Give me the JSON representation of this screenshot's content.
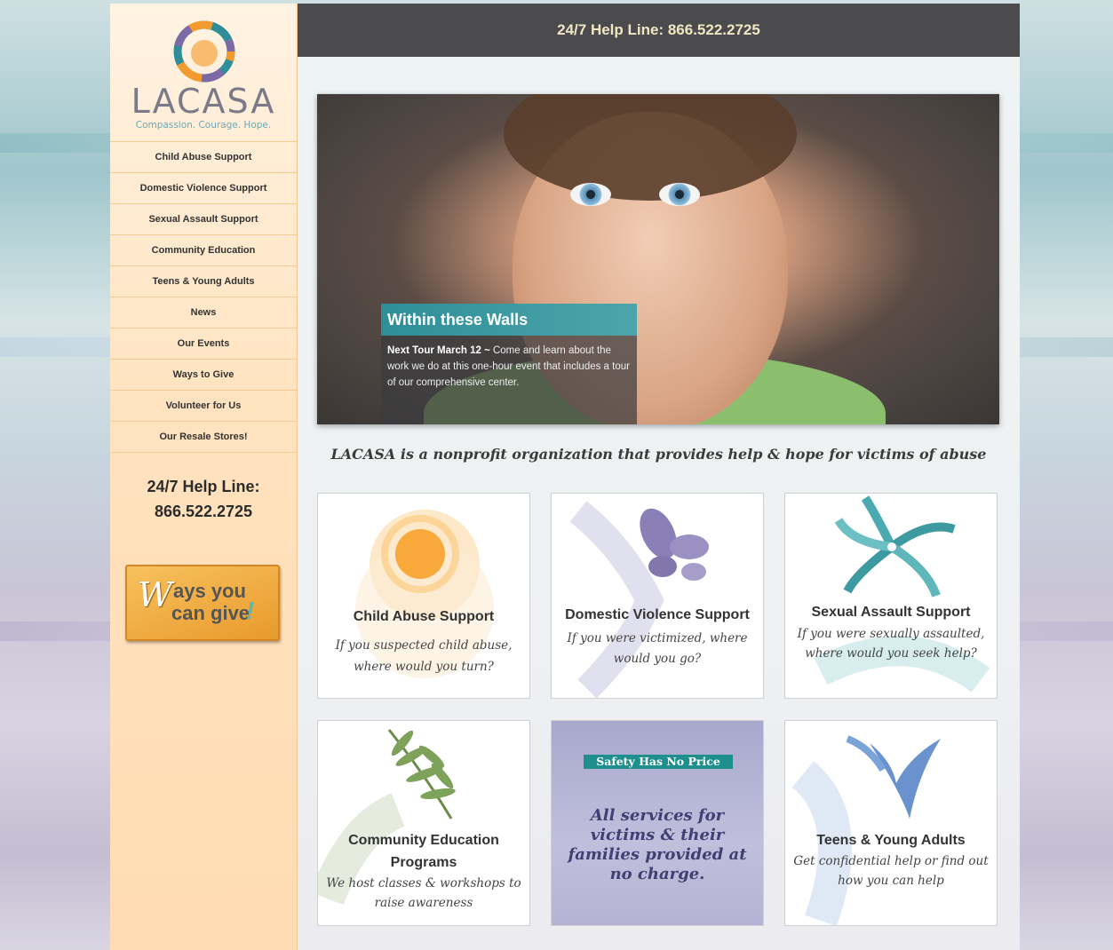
{
  "logo": {
    "name": "LACASA",
    "tagline": "Compassion. Courage. Hope."
  },
  "nav": [
    "Child Abuse Support",
    "Domestic Violence Support",
    "Sexual Assault Support",
    "Community Education",
    "Teens & Young Adults",
    "News",
    "Our Events",
    "Ways to Give",
    "Volunteer for Us",
    "Our Resale Stores!"
  ],
  "sidebar_help": {
    "label": "24/7 Help Line:",
    "number": "866.522.2725"
  },
  "ways_button": {
    "w": "W",
    "line1": "ays you",
    "line2": "can give",
    "bang": "!"
  },
  "topbar": {
    "text": "24/7 Help Line: 866.522.2725"
  },
  "hero": {
    "title": "Within these Walls",
    "lead": "Next Tour March 12 ~",
    "body": " Come and learn about the work we do at this one-hour event that includes a tour of our comprehensive center."
  },
  "tagline": "LACASA is a nonprofit organization that provides help & hope for victims of abuse",
  "tiles": [
    {
      "title": "Child Abuse Support",
      "sub1": "If you suspected child abuse,",
      "sub2": "where would you turn?"
    },
    {
      "title": "Domestic Violence Support",
      "sub1": "If you were victimized, where",
      "sub2": "would you go?"
    },
    {
      "title": "Sexual Assault Support",
      "sub1": "If you were sexually assaulted,",
      "sub2": "where would you seek help?"
    },
    {
      "title1": "Community Education",
      "title2": "Programs",
      "sub1": "We host classes & workshops to",
      "sub2": "raise awareness"
    },
    {
      "banner": "Safety Has No Price",
      "line1": "All services for",
      "line2": "victims & their",
      "line3": "families provided at",
      "line4": "no charge."
    },
    {
      "title": "Teens & Young Adults",
      "sub1": "Get confidential help or find out",
      "sub2": "how you can help"
    }
  ],
  "colors": {
    "accent_teal": "#2f8e98",
    "sidebar_bg": "#ffe2be",
    "topbar_bg": "#4b4b4d"
  }
}
